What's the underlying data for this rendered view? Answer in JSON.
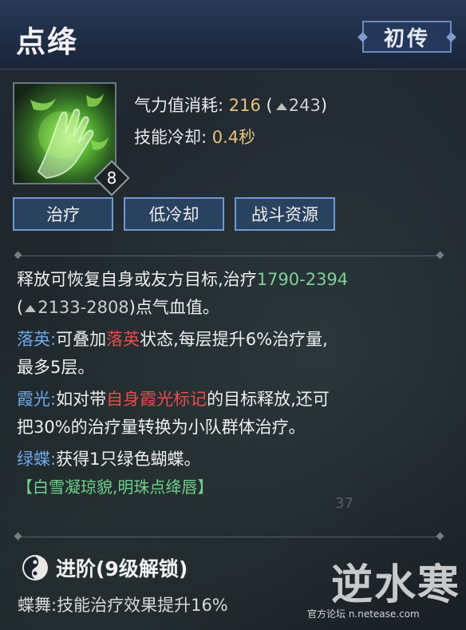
{
  "skill": {
    "name": "点绛",
    "rank": "初传",
    "level": "8",
    "energy_label": "气力值消耗:",
    "energy_value": "216",
    "energy_paren_open": "(",
    "energy_upgrade": "243",
    "energy_paren_close": ")",
    "cooldown_label": "技能冷却:",
    "cooldown_value": "0.4秒"
  },
  "tags": [
    "治疗",
    "低冷却",
    "战斗资源"
  ],
  "description": {
    "line1_prefix": "释放可恢复自身或友方目标,治疗",
    "heal_range": "1790-2394",
    "line2_open": "(",
    "heal_range_up": "2133-2808",
    "line2_suffix": ")点气血值。",
    "luoying_label": "落英:",
    "luoying_text_a": "可叠加",
    "luoying_keyword": "落英",
    "luoying_text_b": "状态,每层提升6%治疗量,",
    "luoying_text_c": "最多5层。",
    "xiaguang_label": "霞光:",
    "xiaguang_text_a": "如对带",
    "xiaguang_keyword": "自身霞光标记",
    "xiaguang_text_b": "的目标释放,还可",
    "xiaguang_text_c": "把30%的治疗量转换为小队群体治疗。",
    "lvdie_label": "绿蝶:",
    "lvdie_text": "获得1只绿色蝴蝶。",
    "tagline": "【白雪凝琼貌,明珠点绛唇】"
  },
  "advance": {
    "title": "进阶(9级解锁)",
    "line_label": "蝶舞:",
    "line_text": "技能治疗效果提升16%"
  },
  "watermark": {
    "logo": "逆水寒",
    "forum": "官方论坛 n.netease.com"
  },
  "background": {
    "number": "37"
  },
  "colors": {
    "header": "#1e2c45",
    "accent_value": "#e7c37a",
    "heal_green": "#7fd199",
    "label_blue": "#6fa8e6",
    "keyword_red": "#e84c4c",
    "tag_border": "#6c9ad3"
  }
}
